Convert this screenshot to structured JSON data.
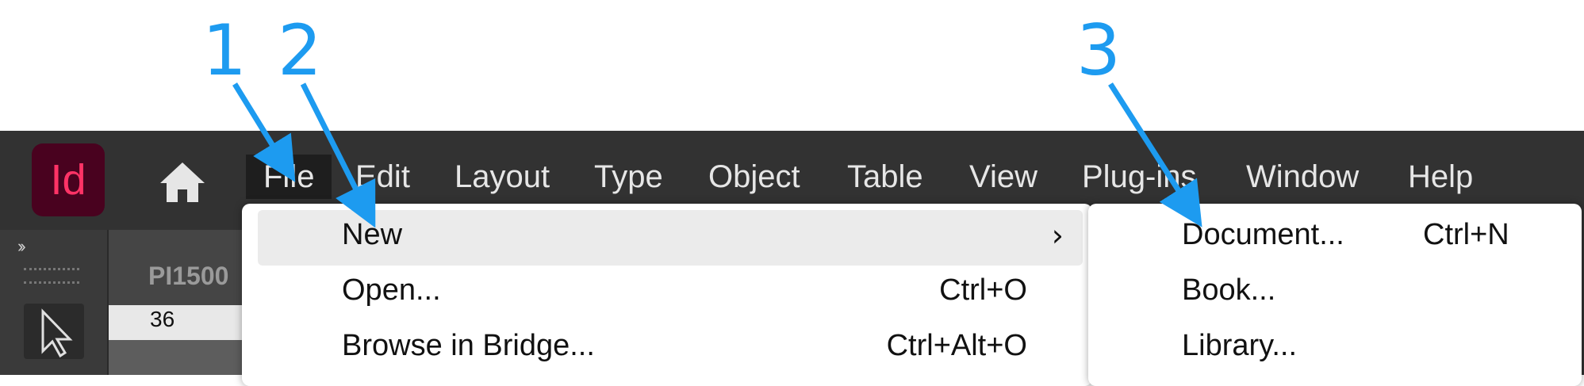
{
  "annotations": [
    "1",
    "2",
    "3"
  ],
  "colors": {
    "annotation": "#1d9bf0",
    "menubar_bg": "#323232",
    "logo_bg": "#49021f",
    "logo_text": "#ff3366"
  },
  "app": {
    "logo_text": "Id",
    "home_icon": "home-icon"
  },
  "menubar": {
    "items": [
      "File",
      "Edit",
      "Layout",
      "Type",
      "Object",
      "Table",
      "View",
      "Plug-ins",
      "Window",
      "Help"
    ],
    "active": "File"
  },
  "toolbar": {
    "collapse_glyph": "››",
    "active_tool": "selection-tool-icon"
  },
  "document": {
    "tab_label": "PI1500",
    "ruler_value": "36"
  },
  "file_menu": {
    "items": [
      {
        "label": "New",
        "shortcut": "",
        "submenu": true
      },
      {
        "label": "Open...",
        "shortcut": "Ctrl+O",
        "submenu": false
      },
      {
        "label": "Browse in Bridge...",
        "shortcut": "Ctrl+Alt+O",
        "submenu": false
      }
    ]
  },
  "new_submenu": {
    "items": [
      {
        "label": "Document...",
        "shortcut": "Ctrl+N"
      },
      {
        "label": "Book...",
        "shortcut": ""
      },
      {
        "label": "Library...",
        "shortcut": ""
      }
    ]
  }
}
